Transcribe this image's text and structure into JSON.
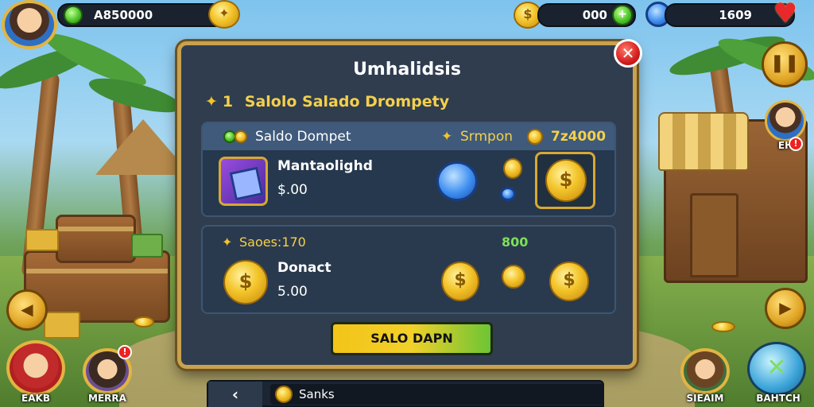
{
  "top_bar": {
    "left_currency": "A850000",
    "center_currency": "000",
    "right_currency": "1609"
  },
  "panel": {
    "title": "Umhalidsis",
    "subtitle_icon": "star-gem",
    "subtitle_count": "1",
    "subtitle_text": "Salolo Salado Drompety",
    "close_symbol": "✕",
    "card1": {
      "header_left": "Saldo Dompet",
      "header_right_label": "Srmpon",
      "header_right_value": "7z4000",
      "item_name": "Mantaolighd",
      "item_price": "$.00"
    },
    "card2": {
      "header_left": "Saoes:170",
      "header_right": "800",
      "item_name": "Donact",
      "item_price": "5.00"
    },
    "main_button": "SALO DAPN"
  },
  "bottom_bar": {
    "back_symbol": "‹",
    "field_text": "Sanks"
  },
  "characters": {
    "bottom_left_1": "EAKB",
    "bottom_left_2": "MERRA",
    "bottom_right_1": "SIEAIM",
    "bottom_right_2": "BAHTCH",
    "right_side": "EH"
  },
  "colors": {
    "panel_bg": "#2f3d4f",
    "panel_border": "#c8a24e",
    "gold": "#f3c42a",
    "accent_green": "#7ee05a",
    "close_red": "#d41e1e"
  }
}
